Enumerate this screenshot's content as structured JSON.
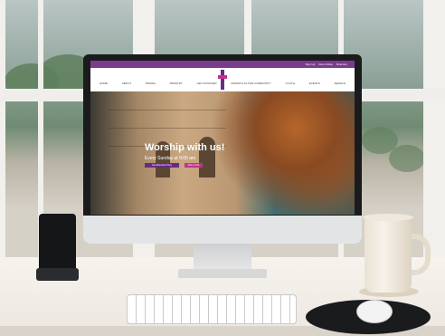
{
  "website": {
    "topbar_links": [
      "Sign Up",
      "Give Online",
      "Directory"
    ],
    "nav_items": [
      "HOME",
      "ABOUT",
      "PARISH",
      "MINISTRY",
      "GET INVOLVED",
      "GROWTH IN OUR COMMUNITY",
      "YOUTH",
      "EVENTS",
      "SEARCH"
    ],
    "hero_title": "Worship with us!",
    "hero_subtitle": "Every Sunday at 9:00 am",
    "hero_button_primary": "Get Directions Here",
    "hero_button_secondary": "Plan a Visit"
  },
  "colors": {
    "brand_purple": "#7a3b8f",
    "accent_magenta": "#c0338b"
  }
}
